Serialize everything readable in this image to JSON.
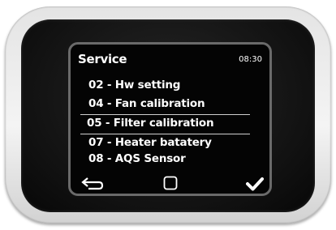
{
  "screen": {
    "title": "Service",
    "clock": "08:30"
  },
  "menu": {
    "items": [
      {
        "label": "02 - Hw setting"
      },
      {
        "label": "04 - Fan calibration"
      },
      {
        "label": "05 - Filter calibration",
        "selected": true
      },
      {
        "label": "07 - Heater batatery"
      },
      {
        "label": "08 - AQS Sensor"
      }
    ]
  },
  "footer": {
    "back_icon": "return-arrow-icon",
    "home_icon": "square-outline-icon",
    "confirm_icon": "checkmark-icon"
  },
  "colors": {
    "screen_background": "#040404",
    "text": "#ffffff",
    "device_shell": "#e8e8e8",
    "bezel": "#111111"
  }
}
